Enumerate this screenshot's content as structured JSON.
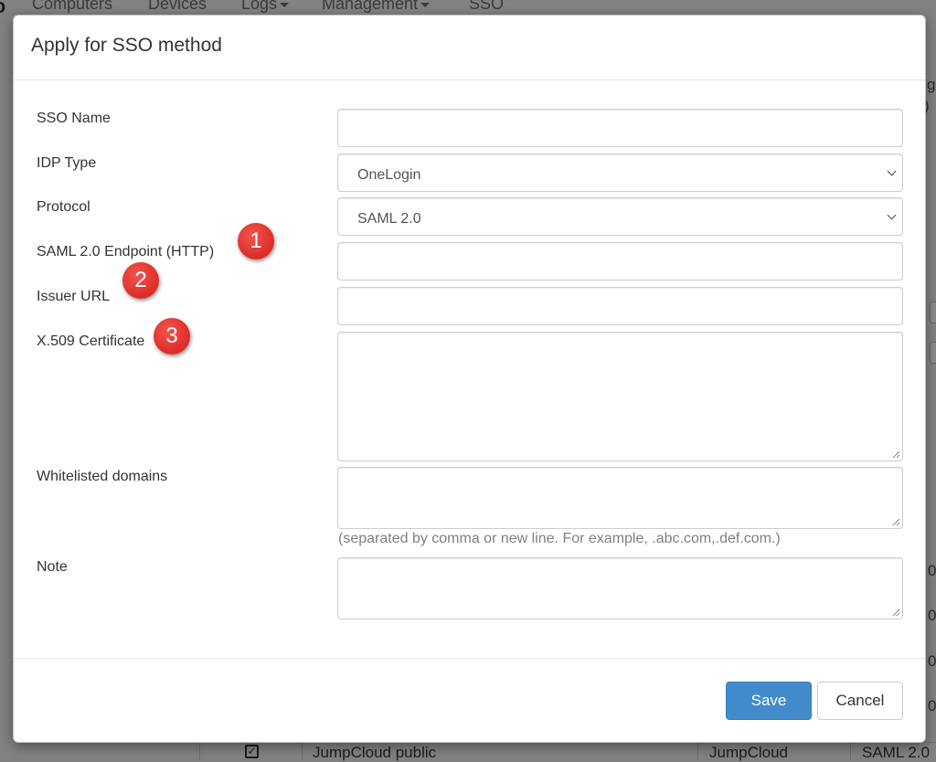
{
  "background": {
    "nav_items": [
      "Computers",
      "Devices",
      "Logs",
      "Management",
      "SSO"
    ],
    "table_row": {
      "name": "JumpCloud public",
      "idp": "JumpCloud",
      "protocol": "SAML 2.0"
    }
  },
  "modal": {
    "title": "Apply for SSO method",
    "fields": {
      "sso_name": {
        "label": "SSO Name",
        "value": ""
      },
      "idp_type": {
        "label": "IDP Type",
        "value": "OneLogin"
      },
      "protocol": {
        "label": "Protocol",
        "value": "SAML 2.0"
      },
      "endpoint": {
        "label": "SAML 2.0 Endpoint (HTTP)",
        "value": ""
      },
      "issuer": {
        "label": "Issuer URL",
        "value": ""
      },
      "certificate": {
        "label": "X.509 Certificate",
        "value": ""
      },
      "whitelisted": {
        "label": "Whitelisted domains",
        "value": "",
        "help": "(separated by comma or new line. For example, .abc.com,.def.com.)"
      },
      "note": {
        "label": "Note",
        "value": ""
      }
    },
    "buttons": {
      "save": "Save",
      "cancel": "Cancel"
    }
  },
  "markers": [
    "1",
    "2",
    "3"
  ],
  "colors": {
    "primary": "#428bca",
    "marker": "#e0312b"
  }
}
